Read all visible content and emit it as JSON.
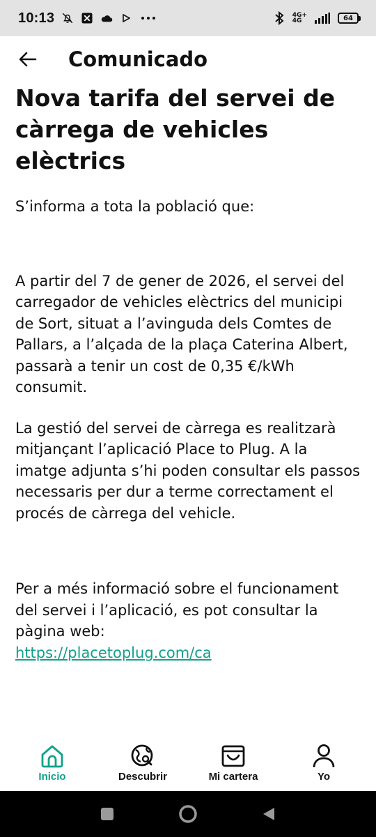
{
  "status_bar": {
    "time": "10:13",
    "network_label_top": "4G+",
    "network_label_bottom": "4G",
    "battery": "64",
    "icons": [
      "bell-off-icon",
      "app-x-icon",
      "cloud-icon",
      "play-icon",
      "more-dots-icon",
      "bluetooth-icon",
      "signal-icon",
      "battery-icon"
    ]
  },
  "header": {
    "title": "Comunicado",
    "back_icon": "arrow-left-icon"
  },
  "article": {
    "title": "Nova tarifa del servei de càrrega de vehicles elèctrics",
    "paragraphs": [
      "S’informa a tota la població que:",
      "A partir del 7 de gener de 2026, el servei del carregador de vehicles elèctrics del municipi de Sort, situat a l’avinguda dels Comtes de Pallars, a l’alçada de la plaça Caterina Albert, passarà a tenir un cost de 0,35 €/kWh consumit.",
      "La gestió del servei de càrrega es realitzarà mitjançant l’aplicació Place to Plug. A la imatge adjunta s’hi poden consultar els passos necessaris per dur a terme correctament el procés de càrrega del vehicle.",
      "Per a més informació sobre el funcionament del servei i l’aplicació, es pot consultar la pàgina web:"
    ],
    "link": "https://placetoplug.com/ca"
  },
  "bottom_nav": {
    "items": [
      {
        "label": "Inicio",
        "icon": "home-icon",
        "active": true
      },
      {
        "label": "Descubrir",
        "icon": "discover-globe-icon",
        "active": false
      },
      {
        "label": "Mi cartera",
        "icon": "wallet-icon",
        "active": false
      },
      {
        "label": "Yo",
        "icon": "user-icon",
        "active": false
      }
    ]
  },
  "colors": {
    "accent": "#12a08a",
    "status_bar_bg": "#e3e3e3",
    "system_nav_bg": "#000000"
  }
}
